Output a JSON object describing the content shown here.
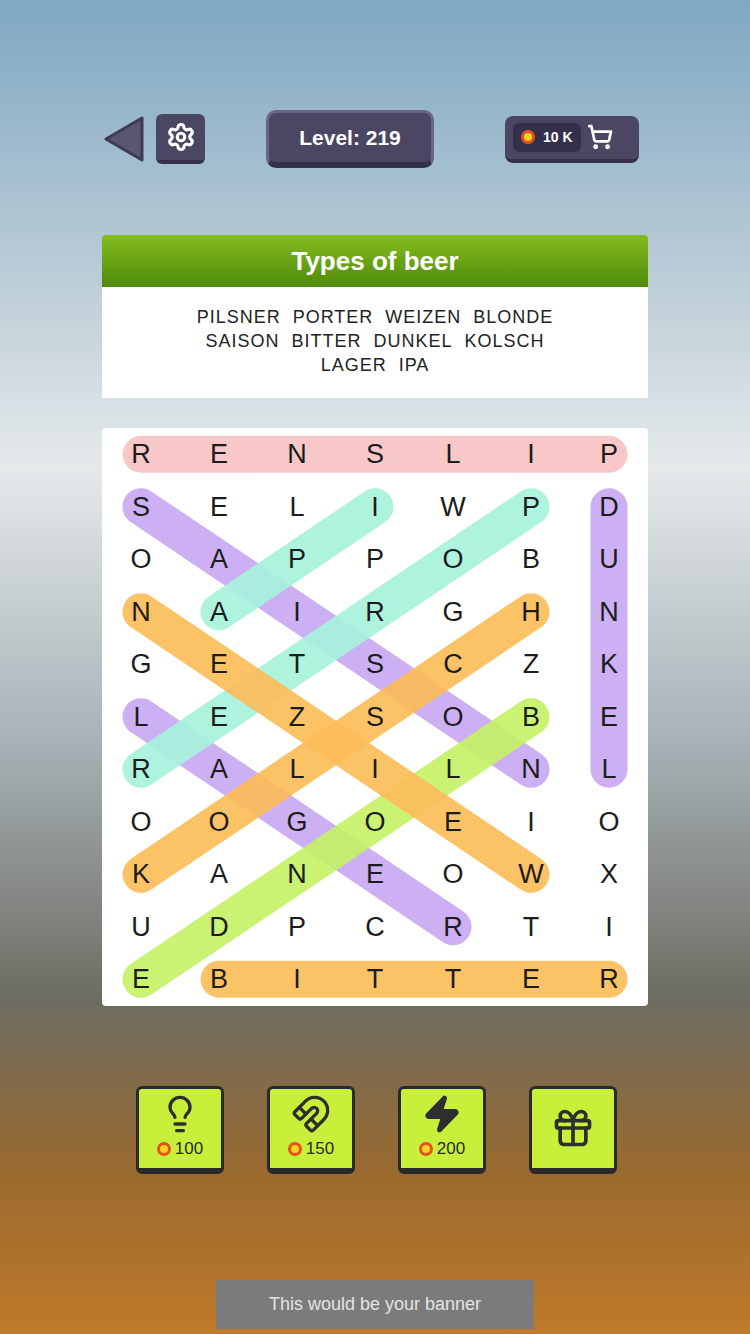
{
  "level": "Level: 219",
  "coins": "10 K",
  "category": "Types of beer",
  "words": [
    "PILSNER",
    "PORTER",
    "WEIZEN",
    "BLONDE",
    "SAISON",
    "BITTER",
    "DUNKEL",
    "KOLSCH",
    "LAGER",
    "IPA"
  ],
  "grid": [
    [
      "R",
      "E",
      "N",
      "S",
      "L",
      "I",
      "P"
    ],
    [
      "S",
      "E",
      "L",
      "I",
      "W",
      "P",
      "D"
    ],
    [
      "O",
      "A",
      "P",
      "P",
      "O",
      "B",
      "U"
    ],
    [
      "N",
      "A",
      "I",
      "R",
      "G",
      "H",
      "N"
    ],
    [
      "G",
      "E",
      "T",
      "S",
      "C",
      "Z",
      "K"
    ],
    [
      "L",
      "E",
      "Z",
      "S",
      "O",
      "B",
      "E"
    ],
    [
      "R",
      "A",
      "L",
      "I",
      "L",
      "N",
      "L"
    ],
    [
      "O",
      "O",
      "G",
      "O",
      "E",
      "I",
      "O"
    ],
    [
      "K",
      "A",
      "N",
      "E",
      "O",
      "W",
      "X"
    ],
    [
      "U",
      "D",
      "P",
      "C",
      "R",
      "T",
      "I"
    ],
    [
      "E",
      "B",
      "I",
      "T",
      "T",
      "E",
      "R"
    ]
  ],
  "highlights": [
    {
      "word": "PILSNER",
      "from": [
        0,
        6
      ],
      "to": [
        0,
        0
      ],
      "color": "#f8c4c4"
    },
    {
      "word": "DUNKEL",
      "from": [
        1,
        6
      ],
      "to": [
        6,
        6
      ],
      "color": "#c9a9f3"
    },
    {
      "word": "BITTER",
      "from": [
        10,
        1
      ],
      "to": [
        10,
        6
      ],
      "color": "#fcbd5a"
    },
    {
      "word": "SAISON",
      "from": [
        1,
        0
      ],
      "to": [
        6,
        5
      ],
      "color": "#c9a9f3"
    },
    {
      "word": "LAGER",
      "from": [
        5,
        0
      ],
      "to": [
        9,
        4
      ],
      "color": "#c9a9f3"
    },
    {
      "word": "PORTER",
      "from": [
        1,
        5
      ],
      "to": [
        6,
        0
      ],
      "color": "#a8f2dc"
    },
    {
      "word": "IPA",
      "from": [
        1,
        3
      ],
      "to": [
        3,
        1
      ],
      "color": "#a8f2dc"
    },
    {
      "word": "BLONDE",
      "from": [
        5,
        5
      ],
      "to": [
        10,
        0
      ],
      "color": "#c6f168"
    },
    {
      "word": "WEIZEN",
      "from": [
        8,
        5
      ],
      "to": [
        3,
        0
      ],
      "color": "#fcbd5a"
    },
    {
      "word": "KOLSCH",
      "from": [
        8,
        0
      ],
      "to": [
        3,
        5
      ],
      "color": "#fcbd5a"
    }
  ],
  "powerups": [
    {
      "kind": "hint",
      "cost": "100"
    },
    {
      "kind": "magnet",
      "cost": "150"
    },
    {
      "kind": "bolt",
      "cost": "200"
    },
    {
      "kind": "gift"
    }
  ],
  "banner": "This would be your banner"
}
